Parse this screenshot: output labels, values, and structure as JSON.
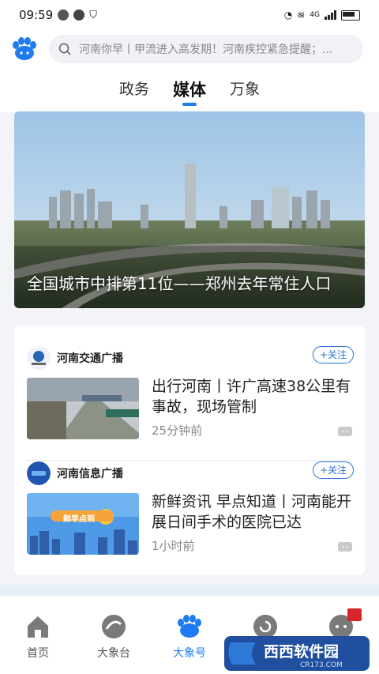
{
  "status_bar": {
    "time": "09:59",
    "network": "4G"
  },
  "search": {
    "placeholder": "河南你早丨甲流进入高发期！河南疾控紧急提醒；..."
  },
  "tabs": [
    {
      "label": "政务"
    },
    {
      "label": "媒体"
    },
    {
      "label": "万象"
    }
  ],
  "active_tab": "媒体",
  "hero": {
    "caption": "全国城市中排第11位——郑州去年常住人口"
  },
  "feed": [
    {
      "source": "河南交通广播",
      "follow_label": "+关注",
      "title": "出行河南丨许广高速38公里有事故，现场管制",
      "time": "25分钟前"
    },
    {
      "source": "河南信息广播",
      "follow_label": "+关注",
      "title": "新鲜资讯 早点知道丨河南能开展日间手术的医院已达",
      "time": "1小时前",
      "thumb_text": "鲜早点到"
    }
  ],
  "nav": [
    {
      "label": "首页",
      "icon": "home-icon"
    },
    {
      "label": "大象台",
      "icon": "elephant-tv-icon"
    },
    {
      "label": "大象号",
      "icon": "paw-icon"
    },
    {
      "label": "",
      "icon": "refresh-icon"
    },
    {
      "label": "",
      "icon": "chat-icon"
    }
  ],
  "watermark": {
    "text": "西西软件园",
    "sub": "CR173.COM"
  },
  "colors": {
    "accent": "#1e7bf0",
    "follow": "#2b6fd6",
    "background": "#f3f4f7"
  }
}
